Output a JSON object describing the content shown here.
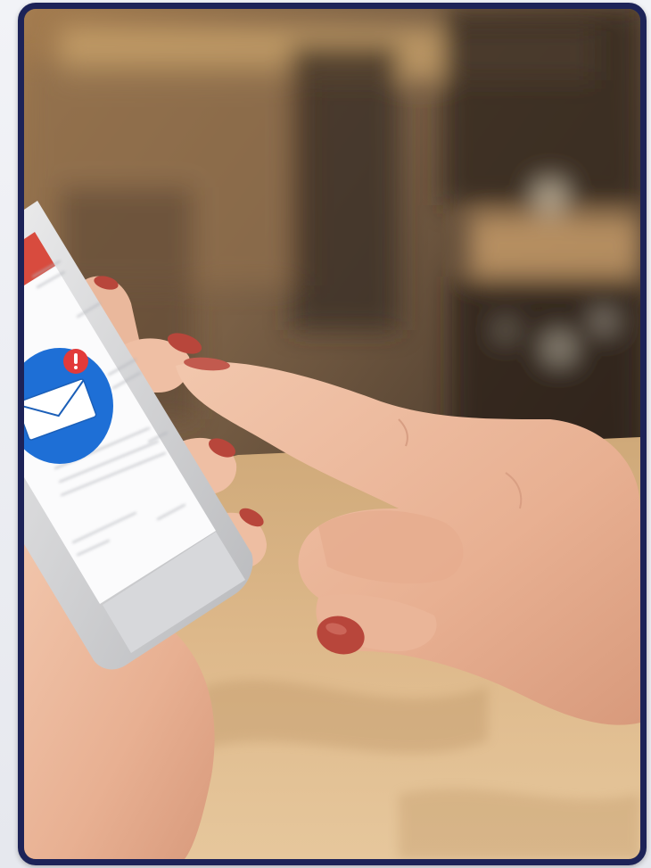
{
  "image": {
    "subject": "photograph",
    "frame_color": "#1d2358",
    "icons": [
      "envelope-icon",
      "alert-badge-icon"
    ],
    "colors": {
      "accent_blue": "#1e6fd6",
      "alert_red": "#e23a3a",
      "nail_polish": "#b8463b",
      "table_wood": "#d9b88a"
    }
  }
}
